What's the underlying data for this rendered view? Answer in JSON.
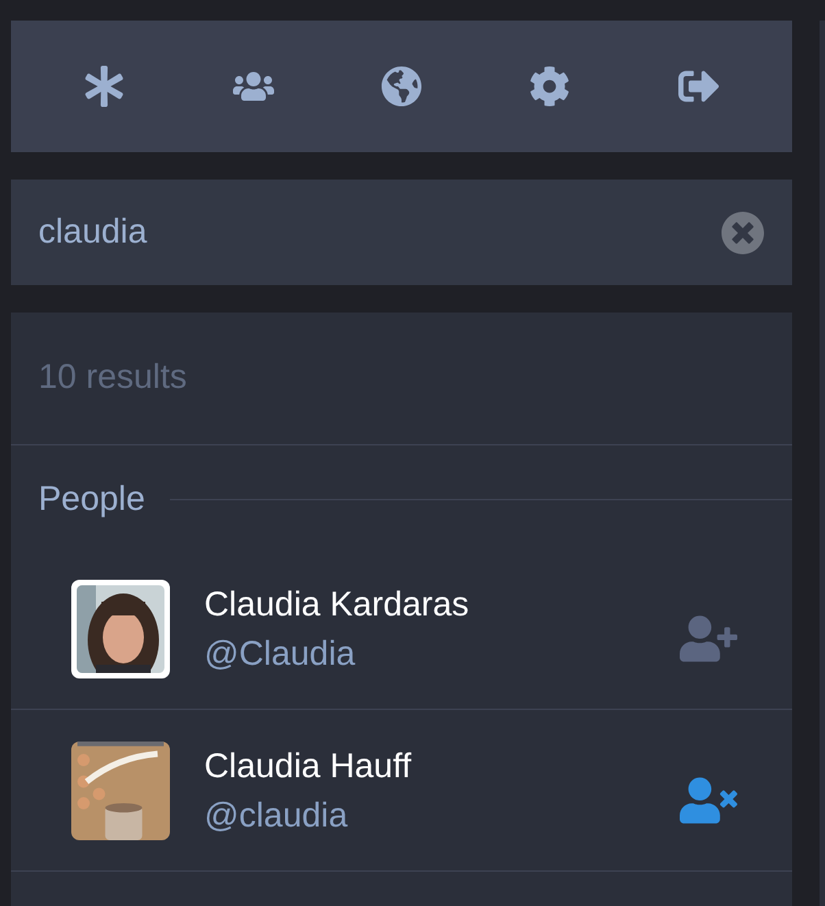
{
  "nav": [
    {
      "kind": "asterisk"
    },
    {
      "kind": "users"
    },
    {
      "kind": "globe"
    },
    {
      "kind": "settings"
    },
    {
      "kind": "logout"
    }
  ],
  "search": {
    "value": "claudia"
  },
  "results_count": "10 results",
  "section": "People",
  "people": [
    {
      "name": "Claudia Kardaras",
      "handle": "@Claudia",
      "following": false
    },
    {
      "name": "Claudia Hauff",
      "handle": "@claudia",
      "following": true
    }
  ]
}
